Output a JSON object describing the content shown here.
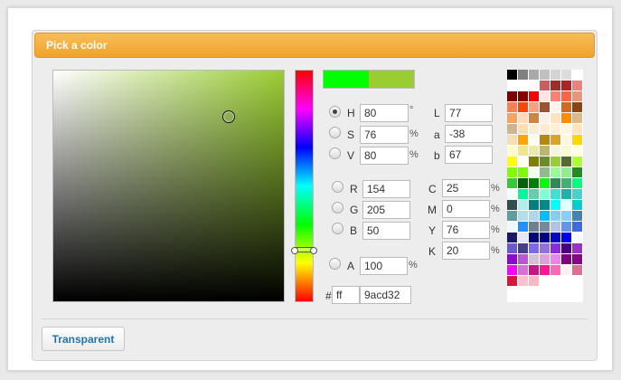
{
  "dialog": {
    "title": "Pick a color",
    "transparent_label": "Transparent"
  },
  "selected_color": "#9acd32",
  "previous_color": "#00ff00",
  "hue_fraction": 0.778,
  "hsv": {
    "h": {
      "label": "H",
      "value": "80",
      "unit": "°"
    },
    "s": {
      "label": "S",
      "value": "76",
      "unit": "%"
    },
    "v": {
      "label": "V",
      "value": "80",
      "unit": "%"
    }
  },
  "lab": {
    "l": {
      "label": "L",
      "value": "77"
    },
    "a": {
      "label": "a",
      "value": "-38"
    },
    "b": {
      "label": "b",
      "value": "67"
    }
  },
  "rgb": {
    "r": {
      "label": "R",
      "value": "154"
    },
    "g": {
      "label": "G",
      "value": "205"
    },
    "b": {
      "label": "B",
      "value": "50"
    }
  },
  "cmyk": {
    "c": {
      "label": "C",
      "value": "25",
      "unit": "%"
    },
    "m": {
      "label": "M",
      "value": "0",
      "unit": "%"
    },
    "y": {
      "label": "Y",
      "value": "76",
      "unit": "%"
    },
    "k": {
      "label": "K",
      "value": "20",
      "unit": "%"
    }
  },
  "alpha": {
    "label": "A",
    "value": "100",
    "unit": "%"
  },
  "hex": {
    "prefix": "#",
    "alpha_value": "ff",
    "value": "9acd32"
  },
  "palette": [
    "#000000",
    "#808080",
    "#a9a9a9",
    "#c0c0c0",
    "#d3d3d3",
    "#dcdcdc",
    "#ffffff",
    "#ffffff",
    "#ffffff",
    "#fffafa",
    "#cd5c5c",
    "#a52a2a",
    "#b22222",
    "#f08080",
    "#800000",
    "#8b0000",
    "#ff0000",
    "#ffe4e1",
    "#fa8072",
    "#ff6347",
    "#e9967a",
    "#ff7f50",
    "#ff4500",
    "#ffa07a",
    "#a0522d",
    "#fff5ee",
    "#d2691e",
    "#8b4513",
    "#f4a460",
    "#ffdab9",
    "#cd853f",
    "#faf0e6",
    "#ffe4c4",
    "#ff8c00",
    "#deb887",
    "#d2b48c",
    "#ffdead",
    "#faebd7",
    "#ffebcd",
    "#ffefd5",
    "#fdf5e6",
    "#ffe4b5",
    "#f5deb3",
    "#ffa500",
    "#fffaf0",
    "#b8860b",
    "#daa520",
    "#fff8dc",
    "#ffd700",
    "#fffacd",
    "#f0e68c",
    "#eee8aa",
    "#bdb76b",
    "#f5f5dc",
    "#fafad2",
    "#ffffe0",
    "#ffff00",
    "#fffff0",
    "#808000",
    "#6b8e23",
    "#9acd32",
    "#556b2f",
    "#adff2f",
    "#7fff00",
    "#7cfc00",
    "#f0fff0",
    "#8fbc8f",
    "#98fb98",
    "#90ee90",
    "#228b22",
    "#32cd32",
    "#006400",
    "#008000",
    "#00ff00",
    "#2e8b57",
    "#3cb371",
    "#00ff7f",
    "#f5fffa",
    "#00fa9a",
    "#66cdaa",
    "#7fffd4",
    "#40e0d0",
    "#20b2aa",
    "#48d1cc",
    "#2f4f4f",
    "#afeeee",
    "#008080",
    "#008b8b",
    "#00ffff",
    "#e0ffff",
    "#00ced1",
    "#5f9ea0",
    "#b0e0e6",
    "#add8e6",
    "#00bfff",
    "#87ceeb",
    "#87cefa",
    "#4682b4",
    "#f0f8ff",
    "#1e90ff",
    "#708090",
    "#778899",
    "#b0c4de",
    "#6495ed",
    "#4169e1",
    "#191970",
    "#e6e6fa",
    "#000080",
    "#00008b",
    "#0000cd",
    "#0000ff",
    "#f8f8ff",
    "#6a5acd",
    "#483d8b",
    "#7b68ee",
    "#9370db",
    "#8a2be2",
    "#4b0082",
    "#9932cc",
    "#9400d3",
    "#ba55d3",
    "#d8bfd8",
    "#dda0dd",
    "#ee82ee",
    "#800080",
    "#8b008b",
    "#ff00ff",
    "#da70d6",
    "#c71585",
    "#ff1493",
    "#ff69b4",
    "#fff0f5",
    "#db7093",
    "#dc143c",
    "#ffc0cb",
    "#ffb6c1"
  ]
}
